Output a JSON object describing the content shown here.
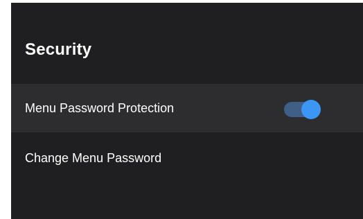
{
  "panel": {
    "title": "Security"
  },
  "settings": [
    {
      "label": "Menu Password Protection",
      "toggle": {
        "checked": true,
        "track_color": "#3f5f87",
        "thumb_color": "#3c96f4"
      }
    },
    {
      "label": "Change Menu Password"
    }
  ],
  "colors": {
    "background": "#1f1f21",
    "focused_row": "#2d2d30",
    "text": "#ffffff"
  }
}
